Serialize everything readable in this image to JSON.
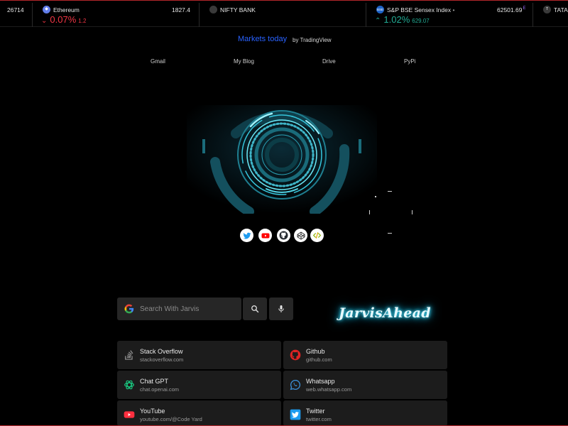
{
  "ticker": {
    "first_price": "26714",
    "items": [
      {
        "name": "Ethereum",
        "price": "1827.4",
        "change_pct": "0.07%",
        "change_abs": "1.2",
        "direction": "down",
        "icon": "ethereum-icon"
      },
      {
        "name": "NIFTY BANK",
        "price": "",
        "change_pct": "",
        "change_abs": "",
        "direction": "none",
        "icon": "nifty-icon"
      },
      {
        "name": "S&P BSE Sensex Index",
        "marker": "•",
        "price": "62501.69",
        "price_suffix": "E",
        "change_pct": "1.02%",
        "change_abs": "629.07",
        "direction": "up",
        "icon": "bse-icon",
        "icon_text": "BSE"
      },
      {
        "name": "TATA M",
        "icon": "tata-icon",
        "icon_text": "T"
      }
    ]
  },
  "header": {
    "markets_today": "Markets today",
    "by": "by TradingView"
  },
  "nav": [
    {
      "label": "Gmail"
    },
    {
      "label": "My Blog"
    },
    {
      "label": "Drive"
    },
    {
      "label": "PyPi"
    }
  ],
  "social": [
    {
      "icon": "twitter-icon",
      "color": "#1d9bf0"
    },
    {
      "icon": "youtube-icon",
      "color": "#ff0000"
    },
    {
      "icon": "github-icon",
      "color": "#24292f"
    },
    {
      "icon": "codepen-icon",
      "color": "#333333"
    },
    {
      "icon": "code-icon",
      "color": "#8bb300"
    }
  ],
  "search": {
    "placeholder": "Search With Jarvis",
    "search_icon": "search-icon",
    "mic_icon": "mic-icon"
  },
  "brand": "JarvisAhead",
  "links": [
    {
      "title": "Stack Overflow",
      "url": "stackoverflow.com",
      "icon": "stackoverflow-icon"
    },
    {
      "title": "Github",
      "url": "github.com",
      "icon": "github-icon"
    },
    {
      "title": "Chat GPT",
      "url": "chat.openai.com",
      "icon": "chatgpt-icon"
    },
    {
      "title": "Whatsapp",
      "url": "web.whatsapp.com",
      "icon": "whatsapp-icon"
    },
    {
      "title": "YouTube",
      "url": "youtube.com/@Code Yard",
      "icon": "youtube-icon"
    },
    {
      "title": "Twitter",
      "url": "twitter.com",
      "icon": "twitter-icon"
    }
  ],
  "colors": {
    "accent_link": "#2962ff",
    "down": "#f23645",
    "up": "#22ab94",
    "card_bg": "#1c1c1c",
    "glow": "#22c5ee",
    "frame": "#b3262a"
  }
}
